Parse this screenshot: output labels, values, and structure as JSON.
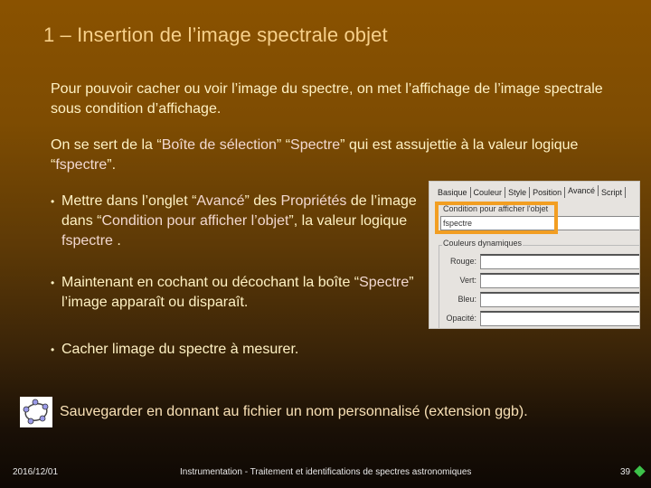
{
  "slide": {
    "title": "1 – Insertion de l’image spectrale objet",
    "intro_paragraph": "Pour pouvoir cacher ou voir l’image du spectre, on met l’affichage de l’image spectrale sous condition d’affichage.",
    "paragraph2": {
      "part1": "On se sert de la “",
      "hl1": "Boîte de sélection",
      "part2": "” “",
      "hl2": "Spectre",
      "part3": "” qui est assujettie à la valeur logique “",
      "hl3": "fspectre",
      "part4": "”."
    },
    "bullets": [
      {
        "part1": "Mettre dans l’onglet “",
        "hl1": "Avancé",
        "part2": "” des ",
        "hl2": "Propriétés",
        "part3": " de l’image dans “",
        "hl3": "Condition pour afficher l’objet",
        "part4": "”, la valeur logique ",
        "hl4": "fspectre",
        "part5": " ."
      },
      {
        "part1": "Maintenant en cochant ou décochant la boîte “",
        "hl1": "Spectre",
        "part2": "” l’image apparaît ou disparaît."
      },
      {
        "text": "Cacher limage du spectre à mesurer."
      }
    ],
    "bullet_glyph": "•",
    "save_note": "Sauvegarder en donnant au fichier un nom personnalisé (extension ggb)."
  },
  "dialog": {
    "tabs": [
      "Basique",
      "Couleur",
      "Style",
      "Position",
      "Avancé",
      "Script"
    ],
    "active_tab": "Avancé",
    "condition_label": "Condition pour afficher l'objet",
    "condition_value": "fspectre",
    "dynamic_colors_label": "Couleurs dynamiques",
    "rows": [
      {
        "label": "Rouge:",
        "value": ""
      },
      {
        "label": "Vert:",
        "value": ""
      },
      {
        "label": "Bleu:",
        "value": ""
      },
      {
        "label": "Opacité:",
        "value": ""
      }
    ],
    "highlight_color": "#f29e22"
  },
  "footer": {
    "date": "2016/12/01",
    "center": "Instrumentation - Traitement et identifications de spectres astronomiques",
    "page_number": "39",
    "nav_color": "#3dc24a"
  }
}
